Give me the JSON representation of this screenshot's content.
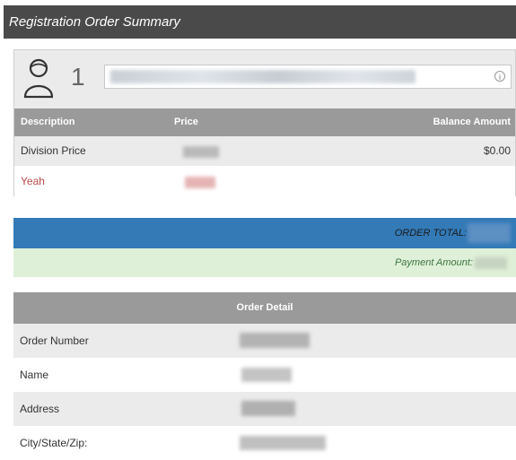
{
  "header": {
    "title": "Registration Order Summary"
  },
  "registrant": {
    "count": "1",
    "icon": "person-icon",
    "info_icon_glyph": "i"
  },
  "summary_table": {
    "columns": [
      "Description",
      "Price",
      "Balance Amount"
    ],
    "rows": [
      {
        "description": "Division Price",
        "price": "",
        "balance": "$0.00"
      },
      {
        "description": "Yeah",
        "price": "",
        "balance": ""
      }
    ]
  },
  "totals": {
    "order_total_label": "ORDER TOTAL:",
    "payment_amount_label": "Payment Amount:"
  },
  "order_detail": {
    "title": "Order Detail",
    "rows": [
      {
        "label": "Order Number"
      },
      {
        "label": "Name"
      },
      {
        "label": "Address"
      },
      {
        "label": "City/State/Zip:"
      }
    ]
  },
  "colors": {
    "header_bg": "#4a4a4a",
    "table_head_bg": "#9a9a9a",
    "total_bar_bg": "#337ab7",
    "payment_bar_bg": "#dff0d8",
    "yeah_text": "#b94a48"
  }
}
